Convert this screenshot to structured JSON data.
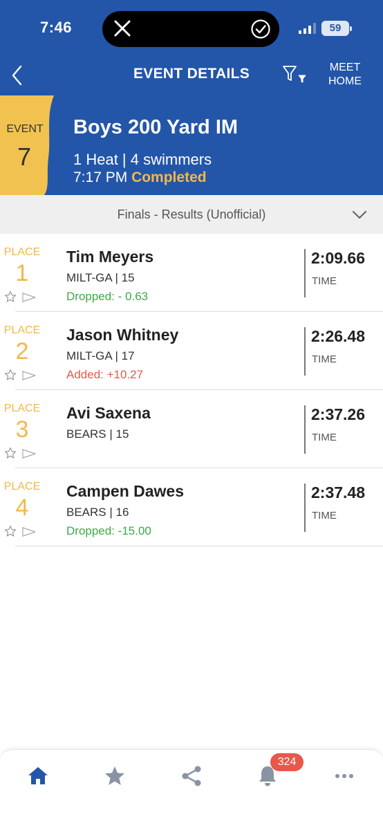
{
  "status_bar": {
    "time": "7:46",
    "battery": "59"
  },
  "nav": {
    "title": "EVENT DETAILS",
    "meet_home_line1": "MEET",
    "meet_home_line2": "HOME"
  },
  "event": {
    "label": "EVENT",
    "number": "7",
    "name": "Boys 200 Yard IM",
    "subtitle": "1 Heat | 4 swimmers",
    "time": "7:17 PM",
    "status": "Completed"
  },
  "results_header": "Finals - Results (Unofficial)",
  "results": [
    {
      "place_label": "PLACE",
      "place": "1",
      "name": "Tim Meyers",
      "team_age": "MILT-GA | 15",
      "delta": "Dropped: - 0.63",
      "delta_type": "dropped",
      "time": "2:09.66",
      "time_label": "TIME"
    },
    {
      "place_label": "PLACE",
      "place": "2",
      "name": "Jason Whitney",
      "team_age": "MILT-GA | 17",
      "delta": "Added: +10.27",
      "delta_type": "added",
      "time": "2:26.48",
      "time_label": "TIME"
    },
    {
      "place_label": "PLACE",
      "place": "3",
      "name": "Avi Saxena",
      "team_age": "BEARS | 15",
      "delta": "",
      "delta_type": "none",
      "time": "2:37.26",
      "time_label": "TIME"
    },
    {
      "place_label": "PLACE",
      "place": "4",
      "name": "Campen Dawes",
      "team_age": "BEARS | 16",
      "delta": "Dropped: -15.00",
      "delta_type": "dropped",
      "time": "2:37.48",
      "time_label": "TIME"
    }
  ],
  "bottom_nav": {
    "items": [
      "home-icon",
      "star-icon",
      "share-icon",
      "bell-icon",
      "more-icon"
    ],
    "notification_count": "324"
  },
  "colors": {
    "brand_blue": "#2356a8",
    "accent_gold": "#f2b84b",
    "dropped_green": "#3aaa46",
    "added_red": "#e8584a"
  }
}
